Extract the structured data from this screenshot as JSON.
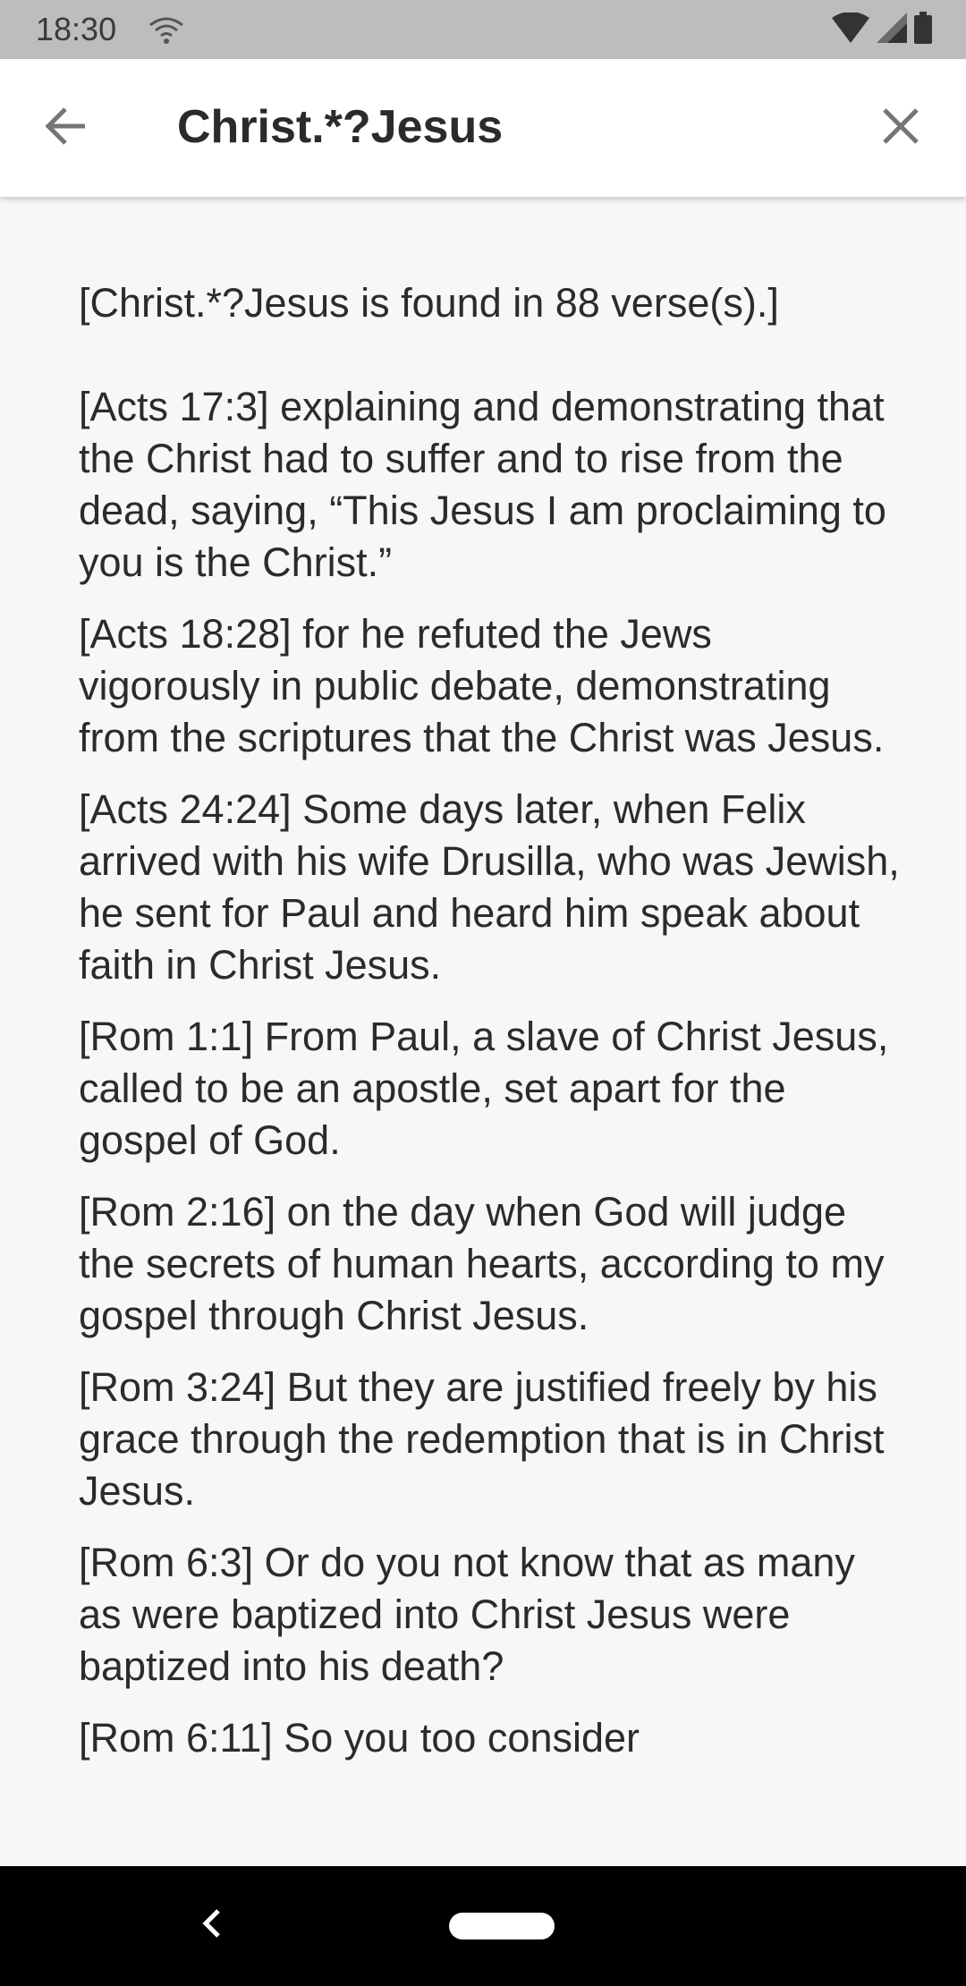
{
  "status_bar": {
    "time": "18:30"
  },
  "app_bar": {
    "search_query": "Christ.*?Jesus",
    "back_icon": "arrow-back-icon",
    "close_icon": "close-icon"
  },
  "results": {
    "summary": "[Christ.*?Jesus is found in 88 verse(s).]",
    "verses": [
      "[Acts 17:3] explaining and demonstrating that the Christ had to suffer and to rise from the dead, saying, “This Jesus I am proclaiming to you is the Christ.”",
      "[Acts 18:28] for he refuted the Jews vigorously in public debate, demonstrating from the scriptures that the Christ was Jesus.",
      "[Acts 24:24] Some days later, when Felix arrived with his wife Drusilla, who was Jewish, he sent for Paul and heard him speak about faith in Christ Jesus.",
      "[Rom 1:1] From Paul, a slave of Christ Jesus, called to be an apostle, set apart for the gospel of God.",
      "[Rom 2:16] on the day when God will judge the secrets of human hearts, according to my gospel through Christ Jesus.",
      "[Rom 3:24] But they are justified freely by his grace through the redemption that is in Christ Jesus.",
      "[Rom 6:3] Or do you not know that as many as were baptized into Christ Jesus were baptized into his death?",
      "[Rom 6:11] So you too consider"
    ]
  },
  "colors": {
    "status_bar_bg": "#bdbdbd",
    "app_bar_bg": "#ffffff",
    "content_bg": "#f7f7f7",
    "text": "#2b2b2b",
    "nav_bar_bg": "#000000"
  }
}
